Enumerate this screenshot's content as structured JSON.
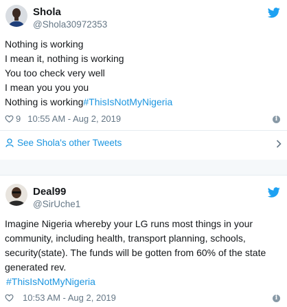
{
  "tweet1": {
    "name": "Shola",
    "handle": "@Shola30972353",
    "lines": [
      "Nothing is working",
      "I mean it, nothing is working",
      "You too check very well",
      "I mean you you you"
    ],
    "last_line_text": "Nothing is working",
    "last_line_hashtag": "#ThisIsNotMyNigeria",
    "likes": "9",
    "timestamp": "10:55 AM - Aug 2, 2019",
    "see_more": "See Shola's other Tweets"
  },
  "tweet2": {
    "name": "Deal99",
    "handle": "@SirUche1",
    "text": "Imagine Nigeria whereby your LG runs most things in your community, including health, transport planning, schools, security(state). The funds will be gotten from 60% of the state generated rev.",
    "hashtag": "#ThisIsNotMyNigeria",
    "timestamp": "10:53 AM - Aug 2, 2019"
  },
  "icons": {
    "twitter_bird": "twitter-bird-icon",
    "heart": "heart-icon",
    "info": "info-icon",
    "person": "person-icon",
    "chevron": "chevron-right-icon"
  },
  "colors": {
    "link": "#1b95e0",
    "muted": "#657786",
    "text": "#14171a",
    "bird": "#1da1f2"
  }
}
